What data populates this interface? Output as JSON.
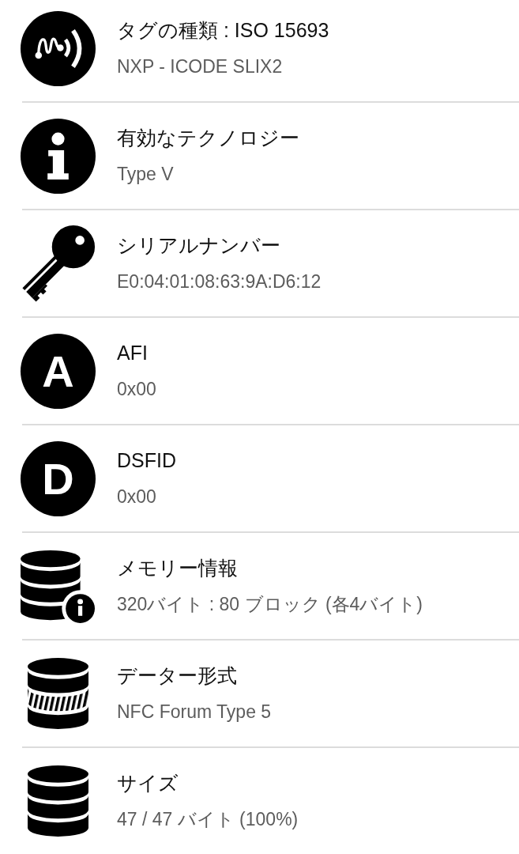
{
  "rows": [
    {
      "kind": "signal",
      "title": "タグの種類 : ISO 15693",
      "value": "NXP - ICODE SLIX2"
    },
    {
      "kind": "info",
      "title": "有効なテクノロジー",
      "value": "Type V"
    },
    {
      "kind": "key",
      "title": "シリアルナンバー",
      "value": "E0:04:01:08:63:9A:D6:12"
    },
    {
      "kind": "letter",
      "letter": "A",
      "title": "AFI",
      "value": "0x00"
    },
    {
      "kind": "letter",
      "letter": "D",
      "title": "DSFID",
      "value": "0x00"
    },
    {
      "kind": "database-info",
      "title": "メモリー情報",
      "value": "320バイト : 80 ブロック (各4バイト)"
    },
    {
      "kind": "database-striped",
      "title": "データー形式",
      "value": "NFC Forum Type 5"
    },
    {
      "kind": "database",
      "title": "サイズ",
      "value": "47 / 47 バイト (100%)"
    }
  ]
}
